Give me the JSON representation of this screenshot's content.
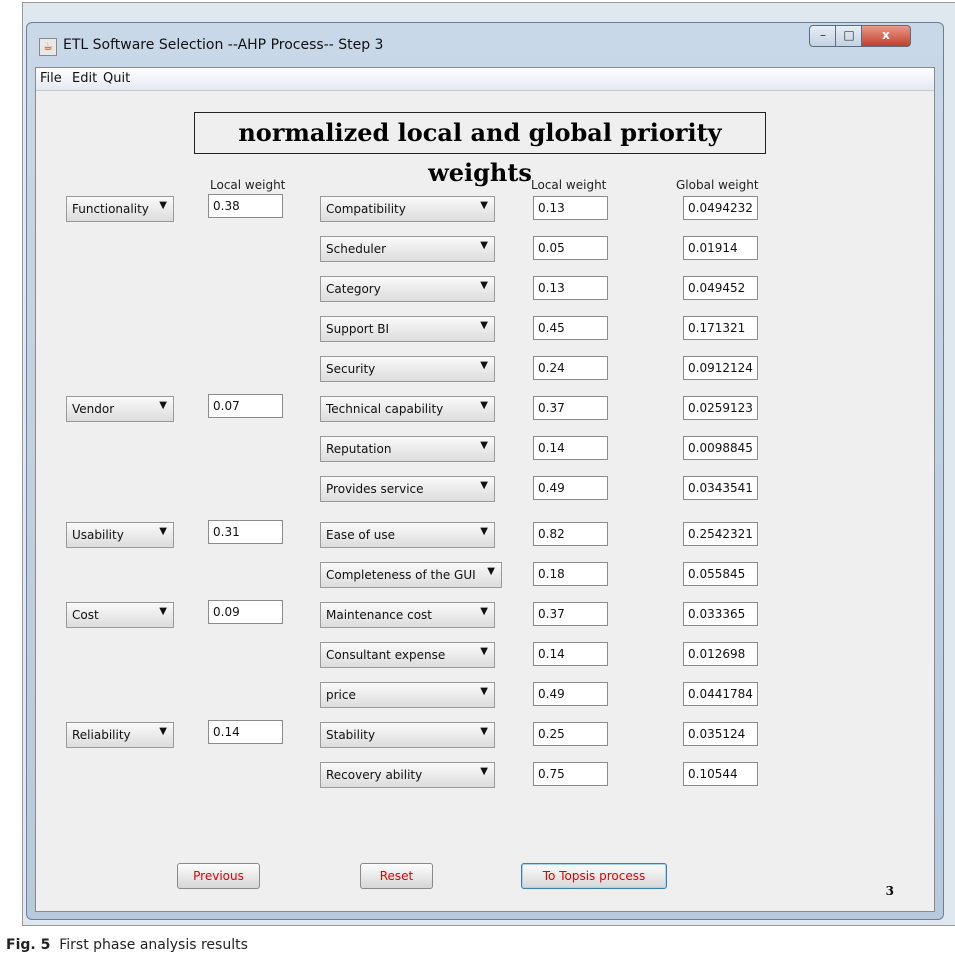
{
  "window": {
    "title": "ETL Software Selection --AHP Process-- Step 3",
    "controls": {
      "minimize": "–",
      "maximize": "□",
      "close": "x"
    }
  },
  "menu": [
    "File",
    "Edit",
    "Quit"
  ],
  "heading": "normalized local and global priority weights",
  "column_headers": {
    "criteria_local": "Local weight",
    "sub_local": "Local weight",
    "global": "Global weight"
  },
  "criteria": [
    {
      "label": "Functionality",
      "local": "0.38"
    },
    {
      "label": "Vendor",
      "local": "0.07"
    },
    {
      "label": "Usability",
      "local": "0.31"
    },
    {
      "label": "Cost",
      "local": "0.09"
    },
    {
      "label": "Reliability",
      "local": "0.14"
    }
  ],
  "subcriteria": [
    {
      "label": "Compatibility",
      "local": "0.13",
      "global": "0.0494232"
    },
    {
      "label": "Scheduler",
      "local": "0.05",
      "global": "0.01914"
    },
    {
      "label": "Category",
      "local": "0.13",
      "global": "0.049452"
    },
    {
      "label": "Support BI",
      "local": "0.45",
      "global": "0.171321"
    },
    {
      "label": "Security",
      "local": "0.24",
      "global": "0.0912124"
    },
    {
      "label": "Technical capability",
      "local": "0.37",
      "global": "0.0259123"
    },
    {
      "label": "Reputation",
      "local": "0.14",
      "global": "0.0098845"
    },
    {
      "label": "Provides service",
      "local": "0.49",
      "global": "0.0343541"
    },
    {
      "label": "Ease of use",
      "local": "0.82",
      "global": "0.2542321"
    },
    {
      "label": "Completeness of the GUI",
      "local": "0.18",
      "global": "0.055845"
    },
    {
      "label": "Maintenance cost",
      "local": "0.37",
      "global": "0.033365"
    },
    {
      "label": "Consultant expense",
      "local": "0.14",
      "global": "0.012698"
    },
    {
      "label": "price",
      "local": "0.49",
      "global": "0.0441784"
    },
    {
      "label": "Stability",
      "local": "0.25",
      "global": "0.035124"
    },
    {
      "label": "Recovery ability",
      "local": "0.75",
      "global": "0.10544"
    }
  ],
  "buttons": {
    "previous": "Previous",
    "reset": "Reset",
    "topsis": "To Topsis process"
  },
  "page_number": "3",
  "caption": {
    "fig": "Fig. 5",
    "text": "First phase analysis results"
  },
  "icons": {
    "dropdown": "chevron-down-icon",
    "app": "java-app-icon"
  }
}
